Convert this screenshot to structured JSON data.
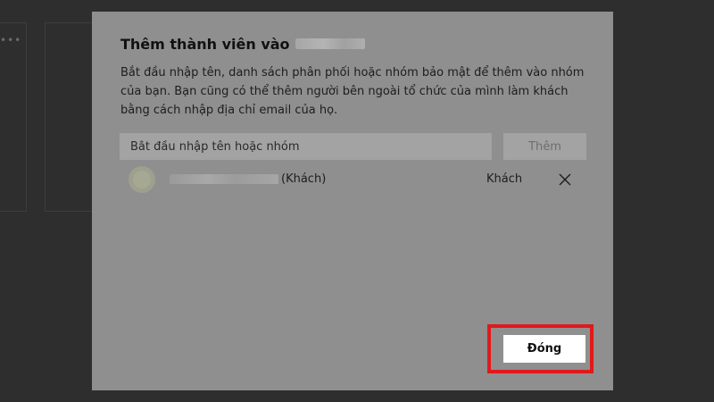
{
  "dialog": {
    "title_prefix": "Thêm thành viên vào",
    "description": "Bắt đầu nhập tên, danh sách phân phối hoặc nhóm bảo mật để thêm vào nhóm của bạn. Bạn cũng có thể thêm người bên ngoài tổ chức của mình làm khách bằng cách nhập địa chỉ email của họ.",
    "search": {
      "placeholder": "Bắt đầu nhập tên hoặc nhóm",
      "value": ""
    },
    "add_button_label": "Thêm",
    "member": {
      "tag": "(Khách)",
      "role": "Khách",
      "remove_icon": "close-icon"
    },
    "close_button_label": "Đóng",
    "highlight_color": "#e0191b"
  }
}
